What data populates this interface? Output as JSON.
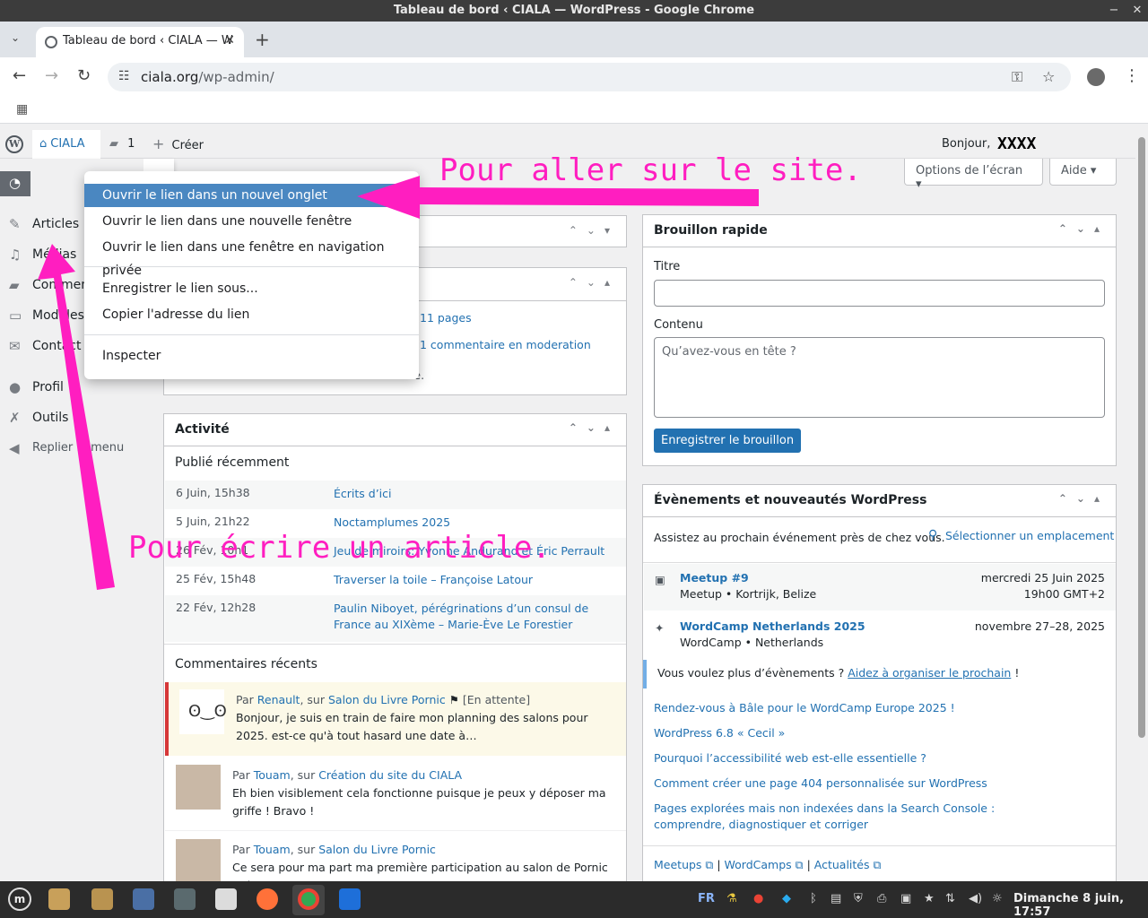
{
  "window": {
    "title": "Tableau de bord ‹ CIALA — WordPress - Google Chrome"
  },
  "browser": {
    "tab_title": "Tableau de bord ‹ CIALA — W",
    "url_host": "ciala.org",
    "url_path": "/wp-admin/"
  },
  "adminbar": {
    "site_name": "CIALA",
    "comments_count": "1",
    "new_label": "Créer",
    "greeting": "Bonjour,",
    "user_name": "XXXX",
    "site_dropdown_item": "Aller sur le site"
  },
  "sidebar": {
    "items": [
      {
        "label": "Articles",
        "icon": "pin-icon"
      },
      {
        "label": "Médias",
        "icon": "media-icon"
      },
      {
        "label": "Commentaires",
        "icon": "comment-icon"
      },
      {
        "label": "Modèles",
        "icon": "folder-icon"
      },
      {
        "label": "Contact",
        "icon": "mail-icon"
      },
      {
        "label": "Profil",
        "icon": "user-icon"
      },
      {
        "label": "Outils",
        "icon": "wrench-icon"
      }
    ],
    "collapse_label": "Replier le menu"
  },
  "screen_options": {
    "options_label": "Options de l’écran",
    "help_label": "Aide"
  },
  "context_menu": {
    "items": [
      "Ouvrir le lien dans un nouvel onglet",
      "Ouvrir le lien dans une nouvelle fenêtre",
      "Ouvrir le lien dans une fenêtre en navigation privée",
      "Enregistrer le lien sous...",
      "Copier l'adresse du lien",
      "Inspecter"
    ]
  },
  "glance": {
    "pages": "11 pages",
    "moderation": "1 commentaire en moderation",
    "footer_fragment": "ite."
  },
  "activity": {
    "title": "Activité",
    "published_heading": "Publié récemment",
    "rows": [
      {
        "date": "6 Juin, 15h38",
        "title": "Écrits d’ici"
      },
      {
        "date": "5 Juin, 21h22",
        "title": "Noctamplumes 2025"
      },
      {
        "date": "26 Fév, 10h1",
        "title": "Jeu de miroirs: Yvonne Andurand et Éric Perrault"
      },
      {
        "date": "25 Fév, 15h48",
        "title": "Traverser la toile – Françoise Latour"
      },
      {
        "date": "22 Fév, 12h28",
        "title": "Paulin Niboyet, pérégrinations d’un consul de France au XIXème – Marie-Ève Le Forestier"
      }
    ],
    "comments_heading": "Commentaires récents",
    "comments": [
      {
        "by": "Par",
        "author": "Renault",
        "on": "sur",
        "post": "Salon du Livre Pornic",
        "status": "[En attente]",
        "text": "Bonjour, je suis en train de faire mon planning des salons pour 2025. est-ce qu'à tout hasard une date à…"
      },
      {
        "by": "Par",
        "author": "Touam",
        "on": "sur",
        "post": "Création du site du CIALA",
        "status": "",
        "text": "Eh bien visiblement cela fonctionne puisque je peux y déposer ma griffe ! Bravo !"
      },
      {
        "by": "Par",
        "author": "Touam",
        "on": "sur",
        "post": "Salon du Livre Pornic",
        "status": "",
        "text": "Ce sera pour ma part ma première participation au salon de Pornic et je"
      }
    ]
  },
  "quick_draft": {
    "title": "Brouillon rapide",
    "title_label": "Titre",
    "title_value": "",
    "content_label": "Contenu",
    "content_placeholder": "Qu’avez-vous en tête ?",
    "save_label": "Enregistrer le brouillon"
  },
  "events": {
    "title": "Évènements et nouveautés WordPress",
    "intro": "Assistez au prochain événement près de chez vous.",
    "select_location": "Sélectionner un emplacement",
    "items": [
      {
        "name": "Meetup #9",
        "type": "Meetup • Kortrijk, Belize",
        "date": "mercredi 25 Juin 2025",
        "time": "19h00 GMT+2"
      },
      {
        "name": "WordCamp Netherlands 2025",
        "type": "WordCamp • Netherlands",
        "date": "novembre 27–28, 2025",
        "time": ""
      }
    ],
    "organize_prefix": "Vous voulez plus d’évènements ?",
    "organize_link": "Aidez à organiser le prochain",
    "organize_suffix": "!",
    "news": [
      "Rendez-vous à Bâle pour le WordCamp Europe 2025 !",
      "WordPress 6.8 « Cecil »",
      "Pourquoi l’accessibilité web est-elle essentielle ?",
      "Comment créer une page 404 personnalisée sur WordPress",
      "Pages explorées mais non indexées dans la Search Console : comprendre, diagnostiquer et corriger"
    ],
    "footer_links": [
      "Meetups",
      "WordCamps",
      "Actualités"
    ]
  },
  "annotations": {
    "site": "Pour aller sur le site.",
    "article": "Pour écrire un article."
  },
  "colors": {
    "annotation": "#ff1ec0",
    "wp_blue": "#2271b1",
    "highlight": "#4a87c1"
  },
  "taskbar": {
    "lang": "FR",
    "clock": "Dimanche  8 juin, 17:57"
  }
}
